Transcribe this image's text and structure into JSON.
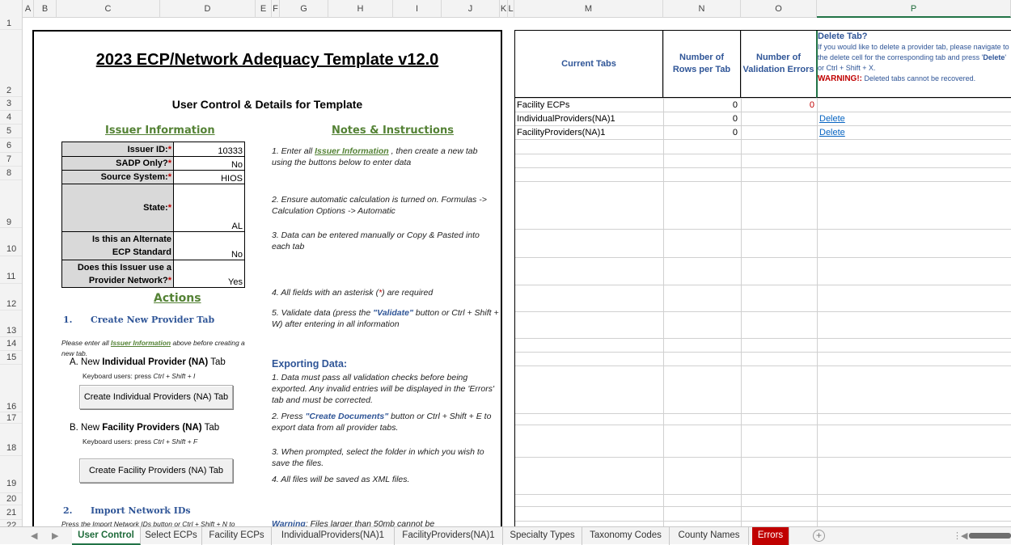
{
  "columns": [
    "A",
    "B",
    "C",
    "D",
    "E",
    "F",
    "G",
    "H",
    "I",
    "J",
    "K",
    "L",
    "M",
    "N",
    "O",
    "P"
  ],
  "rows": [
    "1",
    "2",
    "3",
    "4",
    "5",
    "6",
    "7",
    "8",
    "9",
    "10",
    "11",
    "12",
    "13",
    "14",
    "15",
    "16",
    "17",
    "18",
    "19",
    "20",
    "21",
    "22"
  ],
  "template": {
    "title": "2023 ECP/Network Adequacy Template v12.0",
    "subtitle": "User Control & Details for Template"
  },
  "issuer": {
    "heading": "Issuer Information",
    "fields": [
      {
        "label": "Issuer ID:",
        "required": "*",
        "value": "10333"
      },
      {
        "label": "SADP Only?",
        "required": "*",
        "value": "No"
      },
      {
        "label": "Source System:",
        "required": "*",
        "value": "HIOS"
      },
      {
        "label": "State:",
        "required": "*",
        "value": "AL"
      },
      {
        "label1": "Is this an Alternate",
        "label2": "ECP Standard",
        "value": "No"
      },
      {
        "label1": "Does this Issuer use a",
        "label2": "Provider Network?",
        "required": "*",
        "value": "Yes"
      }
    ]
  },
  "notes": {
    "heading": "Notes & Instructions",
    "n1_a": "1.  Enter all ",
    "n1_link": "Issuer Information",
    "n1_b": " ,  then create a new tab using the buttons below to enter data",
    "n2": "2.  Ensure automatic calculation is turned on. Formulas -> Calculation Options -> Automatic",
    "n3": "3. Data can be entered manually or Copy & Pasted into each tab",
    "n4_a": "4.  All fields with an asterisk (",
    "n4_ast": "*",
    "n4_b": ") are required",
    "n5_a": "5.  Validate data (press the ",
    "n5_key": "\"Validate\"",
    "n5_b": " button or Ctrl + Shift + W) after entering in all information",
    "export_heading": "Exporting Data:",
    "e1": "1.  Data must pass all validation checks before being exported. Any invalid entries will be displayed in the 'Errors' tab and must be corrected.",
    "e2_a": "2.  Press  ",
    "e2_key": "\"Create Documents\"",
    "e2_b": " button or Ctrl + Shift + E to export data from all provider tabs.",
    "e3": "3.  When prompted, select the folder in which you wish to save the files.",
    "e4": "4.  All files will be saved as XML files.",
    "warn_label": "Warning",
    "warn_text": ": Files larger than 50mb cannot be"
  },
  "actions": {
    "heading": "Actions",
    "step1_num": "1.",
    "step1": "Create New Provider Tab",
    "pre_a": "Please enter all ",
    "pre_link": "Issuer Information",
    "pre_b": " above before creating a",
    "pre_c": "new tab.",
    "a_prefix": "A.  New ",
    "a_bold": "Individual Provider (NA)",
    "a_suffix": " Tab",
    "a_kb_label": "Keyboard users: press ",
    "a_kb": "Ctrl + Shift + I",
    "a_button": "Create Individual Providers (NA) Tab",
    "b_prefix": "B.  New ",
    "b_bold": "Facility Providers (NA)",
    "b_suffix": " Tab",
    "b_kb_label": "Keyboard users: press ",
    "b_kb": "Ctrl + Shift + F",
    "b_button": "Create Facility Providers (NA) Tab",
    "step2_num": "2.",
    "step2": "Import Network IDs",
    "step2_note": "Press the Import Network IDs button or Ctrl + Shift + N to"
  },
  "tabs_table": {
    "headers": [
      "Current Tabs",
      "Number of Rows per Tab",
      "Number of Validation Errors"
    ],
    "delete_title": "Delete Tab?",
    "delete_desc_a": "If you would like to delete a provider tab, please navigate to the delete cell for the corresponding tab and press '",
    "delete_key": "Delete",
    "delete_desc_b": "' or Ctrl + Shift + X.",
    "warning_label": "WARNING!:",
    "warning_text": " Deleted tabs cannot be recovered.",
    "rows": [
      {
        "name": "Facility ECPs",
        "rows": "0",
        "errors": "0",
        "action": ""
      },
      {
        "name": "IndividualProviders(NA)1",
        "rows": "0",
        "errors": "",
        "action": "Delete"
      },
      {
        "name": "FacilityProviders(NA)1",
        "rows": "0",
        "errors": "",
        "action": "Delete"
      }
    ]
  },
  "sheet_tabs": [
    "User Control",
    "Select ECPs",
    "Facility ECPs",
    "IndividualProviders(NA)1",
    "FacilityProviders(NA)1",
    "Specialty Types",
    "Taxonomy Codes",
    "County Names",
    "Errors"
  ],
  "colors": {
    "accent_green": "#217346",
    "heading_green": "#548235",
    "blue": "#2f5597",
    "red": "#c00000"
  }
}
